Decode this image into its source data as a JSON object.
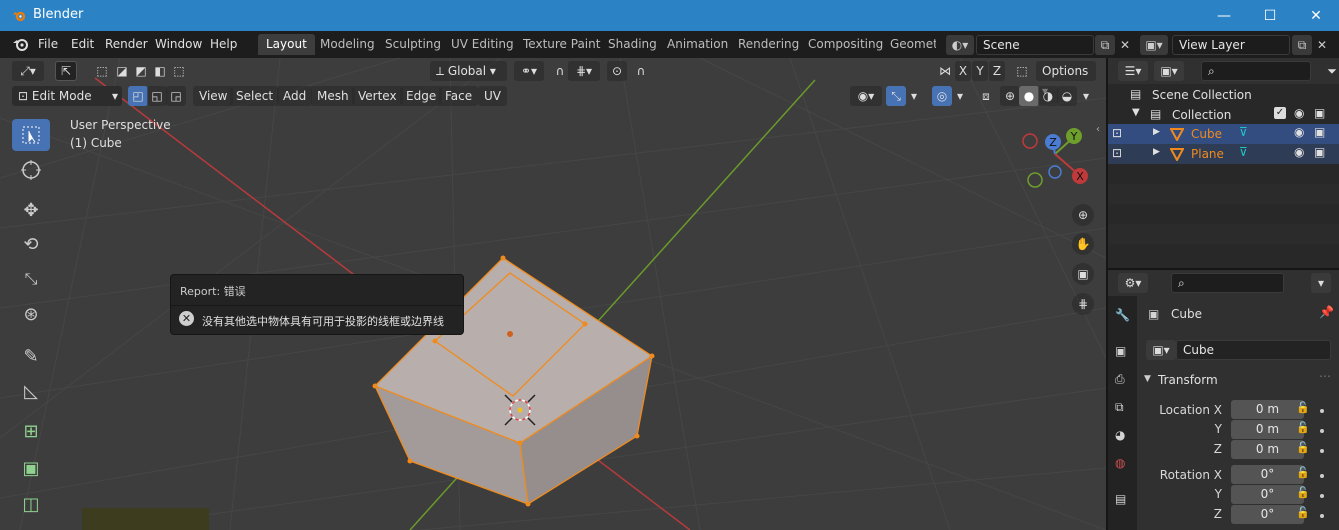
{
  "window": {
    "title": "Blender",
    "minimize": "—",
    "maximize": "☐",
    "close": "✕"
  },
  "menu": {
    "items": [
      "File",
      "Edit",
      "Render",
      "Window",
      "Help"
    ]
  },
  "workspaces": [
    "Layout",
    "Modeling",
    "Sculpting",
    "UV Editing",
    "Texture Paint",
    "Shading",
    "Animation",
    "Rendering",
    "Compositing",
    "Geometr"
  ],
  "active_workspace": "Layout",
  "scene": {
    "name": "Scene"
  },
  "view_layer": {
    "name": "View Layer"
  },
  "viewport": {
    "transform_orientation": "Global",
    "options_label": "Options",
    "mode": "Edit Mode",
    "header_menus": [
      "View",
      "Select",
      "Add",
      "Mesh",
      "Vertex",
      "Edge",
      "Face",
      "UV"
    ],
    "axis_toggles": [
      "X",
      "Y",
      "Z"
    ],
    "perspective_label": "User Perspective",
    "object_label": "(1) Cube",
    "gizmo_axes": {
      "x": "X",
      "y": "Y",
      "z": "Z"
    },
    "colors": {
      "x_axis": "#c0393b",
      "y_axis": "#6e9e2c",
      "mesh_face": "#8b8585",
      "mesh_edge": "#f08a1c",
      "selection": "#4772b3"
    }
  },
  "report": {
    "title": "Report: 错误",
    "message": "没有其他选中物体具有可用于投影的线框或边界线",
    "icon": "error-icon"
  },
  "outliner": {
    "scene_collection": "Scene Collection",
    "collection": "Collection",
    "objects": [
      {
        "name": "Cube",
        "selected": true
      },
      {
        "name": "Plane",
        "selected": false
      }
    ]
  },
  "properties": {
    "object_name": "Cube",
    "data_name": "Cube",
    "panel": "Transform",
    "location_label": "Location X",
    "rotation_label": "Rotation X",
    "y_label": "Y",
    "z_label": "Z",
    "location": [
      "0 m",
      "0 m",
      "0 m"
    ],
    "rotation": [
      "0°",
      "0°",
      "0°"
    ]
  }
}
